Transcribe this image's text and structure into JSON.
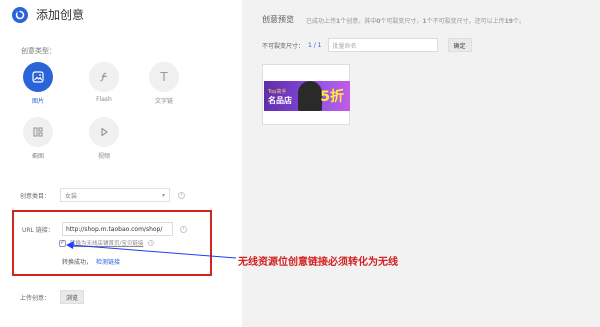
{
  "app": {
    "title": "添加创意",
    "accent": "#2b63d8",
    "annotation_color": "#d22222"
  },
  "left_panel": {
    "type_section_label": "创意类型：",
    "types": [
      {
        "label": "图片",
        "icon": "image-icon",
        "active": true
      },
      {
        "label": "Flash",
        "icon": "flash-icon",
        "active": false
      },
      {
        "label": "文字链",
        "icon": "text-icon",
        "active": false
      },
      {
        "label": "橱图",
        "icon": "grid-icon",
        "active": false
      },
      {
        "label": "视频",
        "icon": "play-icon",
        "active": false
      }
    ],
    "category": {
      "label": "创意类目：",
      "value": "女装"
    },
    "url": {
      "label": "URL 链接：",
      "value": "http://shop.m.taobao.com/shop/",
      "convert_text": "转换为无线店铺首页/宝贝链接",
      "success_text": "转换成功，",
      "detect_link": "检测链接"
    },
    "upload": {
      "label": "上传创意：",
      "button": "浏览"
    },
    "info_icon": "i"
  },
  "annotation": {
    "text": "无线资源位创意链接必须转化为无线"
  },
  "right_panel": {
    "title": "创意预览",
    "stats": {
      "prefix": "已成功上传",
      "count1": "1",
      "mid1": "个创意，其中",
      "count2": "0",
      "mid2": "个可裂变尺寸，",
      "count3": "1",
      "mid3": "个不可裂变尺寸。还可以上传",
      "count4": "19",
      "suffix": "个。"
    },
    "nonsplit_label": "不可裂变尺寸：",
    "page": "1 / 1",
    "name_placeholder": "批量命名",
    "confirm_button": "确定",
    "thumb": {
      "text1": "Top高手",
      "text2": "名品店",
      "text3": "5折"
    }
  }
}
